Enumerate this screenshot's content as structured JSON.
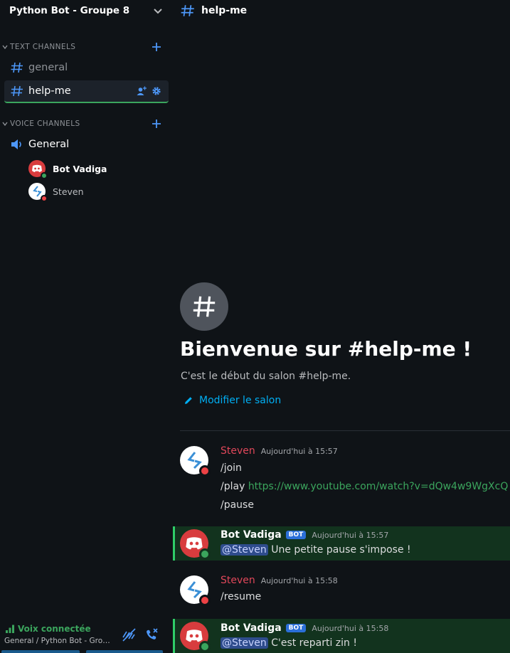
{
  "server": {
    "name": "Python Bot - Groupe 8"
  },
  "categories": {
    "text": "TEXT CHANNELS",
    "voice": "VOICE CHANNELS"
  },
  "text_channels": [
    {
      "label": "general",
      "active": false
    },
    {
      "label": "help-me",
      "active": true
    }
  ],
  "voice_channel": {
    "label": "General",
    "users": [
      {
        "name": "Bot Vadiga",
        "status": "online"
      },
      {
        "name": "Steven",
        "status": "dnd"
      }
    ]
  },
  "voice_panel": {
    "status": "Voix connectée",
    "location": "General / Python Bot - Grou..."
  },
  "topbar": {
    "channel": "help-me"
  },
  "welcome": {
    "title": "Bienvenue sur #help-me !",
    "subtitle": "C'est le début du salon #help-me.",
    "edit_label": "Modifier le salon"
  },
  "messages": [
    {
      "author": "Steven",
      "time": "Aujourd'hui à 15:57",
      "lines": [
        {
          "text": "/join"
        },
        {
          "prefix": "/play ",
          "link": "https://www.youtube.com/watch?v=dQw4w9WgXcQ"
        },
        {
          "text": "/pause"
        }
      ]
    },
    {
      "author": "Bot Vadiga",
      "badge": "BOT",
      "time": "Aujourd'hui à 15:57",
      "mention": "@Steven",
      "text": " Une petite pause s'impose !"
    },
    {
      "author": "Steven",
      "time": "Aujourd'hui à 15:58",
      "lines": [
        {
          "text": "/resume"
        }
      ]
    },
    {
      "author": "Bot Vadiga",
      "badge": "BOT",
      "time": "Aujourd'hui à 15:58",
      "mention": "@Steven",
      "text": " C'est reparti zin !"
    }
  ],
  "colors": {
    "accent": "#3ba55d",
    "link": "#00aff4",
    "steven_name": "#e0475a",
    "highlight_bg": "#12331e",
    "bot_badge": "#2b6fd8"
  },
  "icons": {
    "chevron": "chevron-down-icon",
    "hash": "hash-icon",
    "plus": "plus-icon",
    "speaker": "speaker-icon",
    "invite": "add-user-icon",
    "settings": "gear-icon",
    "signal": "signal-icon",
    "noise": "noise-suppression-icon",
    "disconnect": "disconnect-icon",
    "pencil": "pencil-icon"
  }
}
